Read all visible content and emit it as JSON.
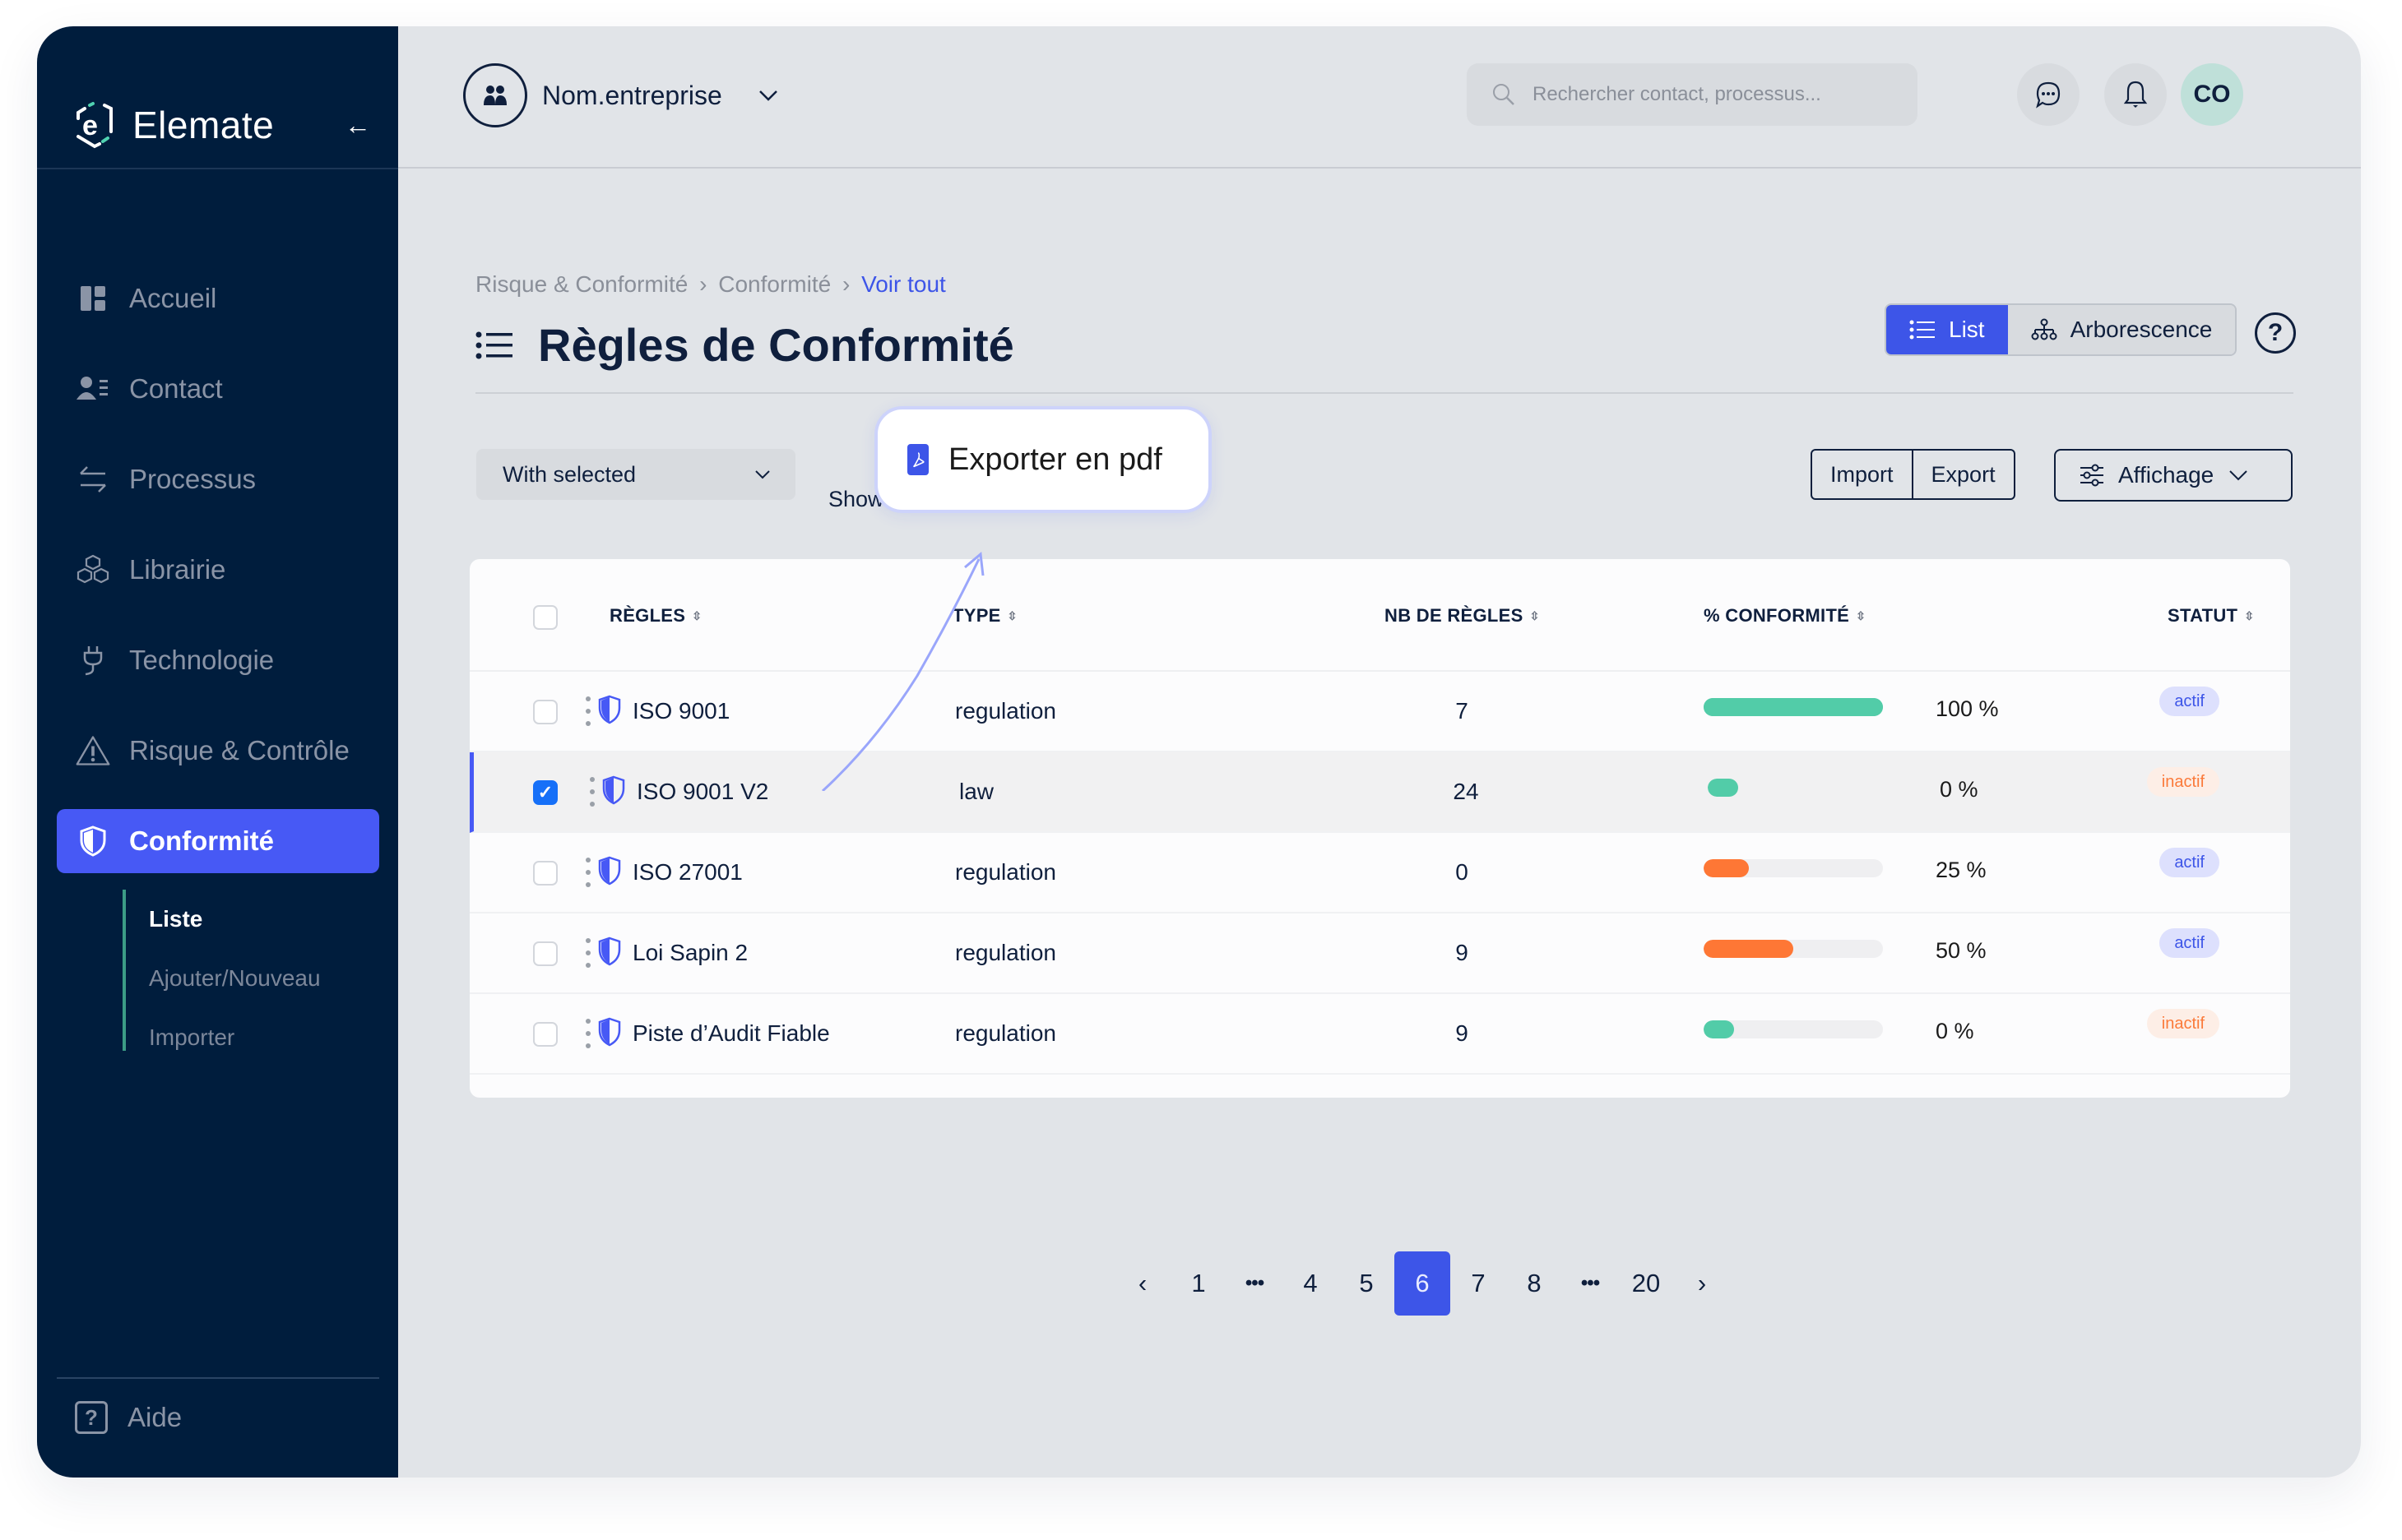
{
  "brand": {
    "name": "Elemate"
  },
  "sidebar": {
    "items": [
      {
        "label": "Accueil",
        "icon": "dashboard-icon",
        "active": false
      },
      {
        "label": "Contact",
        "icon": "contact-list-icon",
        "active": false
      },
      {
        "label": "Processus",
        "icon": "arrows-exchange-icon",
        "active": false
      },
      {
        "label": "Librairie",
        "icon": "cubes-icon",
        "active": false
      },
      {
        "label": "Technologie",
        "icon": "plug-icon",
        "active": false
      },
      {
        "label": "Risque & Contrôle",
        "icon": "warning-triangle-icon",
        "active": false
      },
      {
        "label": "Conformité",
        "icon": "shield-icon",
        "active": true
      }
    ],
    "subitems": [
      {
        "label": "Liste",
        "active": true
      },
      {
        "label": "Ajouter/Nouveau",
        "active": false
      },
      {
        "label": "Importer",
        "active": false
      }
    ],
    "help_label": "Aide"
  },
  "topbar": {
    "company": "Nom.entreprise",
    "search_placeholder": "Rechercher contact, processus...",
    "avatar_initials": "CO"
  },
  "breadcrumb": {
    "items": [
      "Risque & Conformité",
      "Conformité"
    ],
    "current": "Voir tout",
    "separator": "›"
  },
  "page": {
    "title": "Règles de Conformité",
    "view_list": "List",
    "view_tree": "Arborescence",
    "help": "?"
  },
  "toolbar": {
    "with_selected": "With selected",
    "show_label": "Show",
    "import": "Import",
    "export": "Export",
    "affichage": "Affichage"
  },
  "popover": {
    "label": "Exporter en pdf"
  },
  "table": {
    "columns": [
      "RÈGLES",
      "TYPE",
      "NB DE RÈGLES",
      "% CONFORMITÉ",
      "STATUT"
    ],
    "rows": [
      {
        "name": "ISO 9001",
        "type": "regulation",
        "count": "7",
        "conformity": 100,
        "conformity_label": "100 %",
        "bar_color": "#52cca8",
        "status": "actif",
        "checked": false
      },
      {
        "name": "ISO 9001 V2",
        "type": "law",
        "count": "24",
        "conformity": 0,
        "conformity_label": "0 %",
        "bar_color": "#52cca8",
        "status": "inactif",
        "checked": true
      },
      {
        "name": "ISO 27001",
        "type": "regulation",
        "count": "0",
        "conformity": 25,
        "conformity_label": "25 %",
        "bar_color": "#fe7735",
        "status": "actif",
        "checked": false
      },
      {
        "name": "Loi Sapin 2",
        "type": "regulation",
        "count": "9",
        "conformity": 50,
        "conformity_label": "50 %",
        "bar_color": "#fe7735",
        "status": "actif",
        "checked": false
      },
      {
        "name": "Piste d’Audit Fiable",
        "type": "regulation",
        "count": "9",
        "conformity": 0,
        "conformity_label": "0 %",
        "bar_color": "#52cca8",
        "status": "inactif",
        "checked": false
      }
    ]
  },
  "pagination": {
    "prev": "‹",
    "next": "›",
    "pages": [
      "1",
      "•••",
      "4",
      "5",
      "6",
      "7",
      "8",
      "•••",
      "20"
    ],
    "current": "6"
  },
  "colors": {
    "sidebar_bg": "#001d3d",
    "accent": "#3d55e8",
    "active_nav": "#4759f5",
    "success": "#52cca8",
    "warning": "#fe7735"
  }
}
